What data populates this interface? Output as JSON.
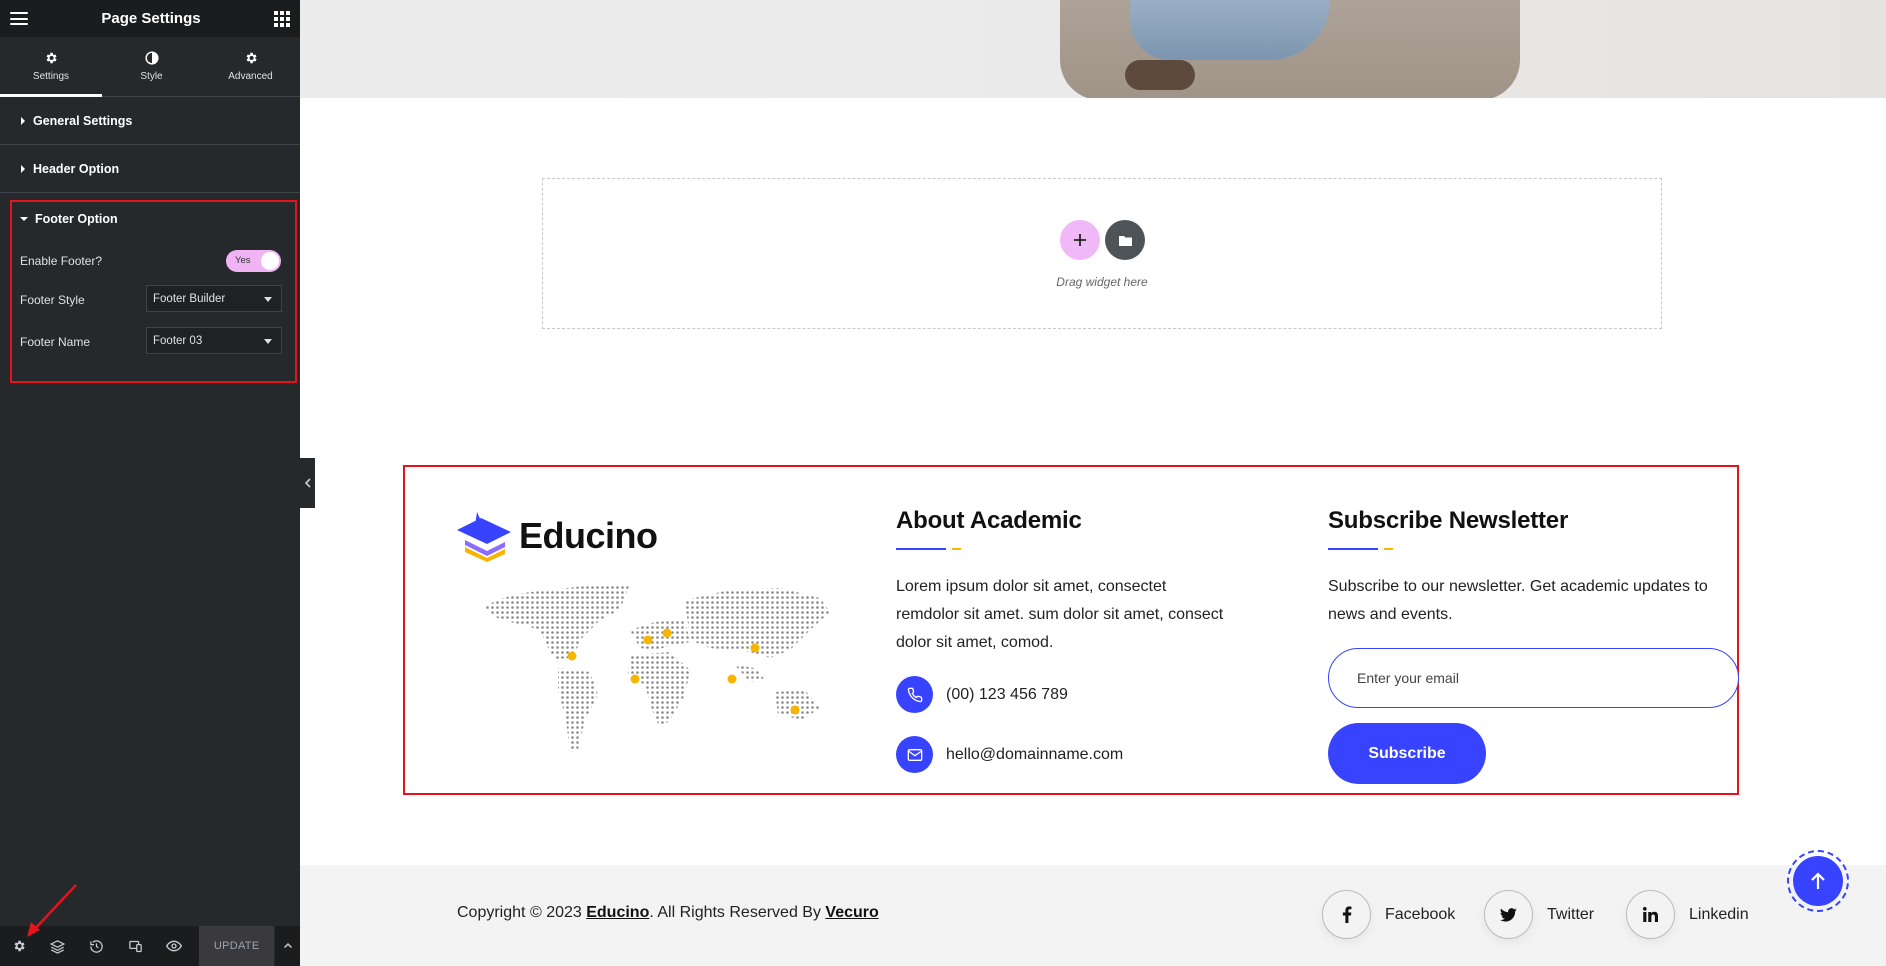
{
  "panel": {
    "title": "Page Settings",
    "tabs": [
      {
        "label": "Settings",
        "icon": "gear-icon"
      },
      {
        "label": "Style",
        "icon": "contrast-icon"
      },
      {
        "label": "Advanced",
        "icon": "gear-icon"
      }
    ],
    "sections": {
      "general": "General Settings",
      "header": "Header Option",
      "footer": "Footer Option"
    },
    "footer_controls": {
      "enable_label": "Enable Footer?",
      "enable_value": "Yes",
      "style_label": "Footer Style",
      "style_value": "Footer Builder",
      "name_label": "Footer Name",
      "name_value": "Footer 03"
    },
    "bottom": {
      "update_label": "UPDATE"
    }
  },
  "drop_zone": {
    "text": "Drag widget here"
  },
  "footer": {
    "brand": "Educino",
    "about": {
      "title": "About Academic",
      "text": "Lorem ipsum dolor sit amet, consectet remdolor sit amet. sum dolor sit amet, consect dolor sit amet, comod.",
      "phone": "(00) 123 456 789",
      "email": "hello@domainname.com"
    },
    "newsletter": {
      "title": "Subscribe Newsletter",
      "text": "Subscribe to our newsletter. Get academic updates to news and events.",
      "placeholder": "Enter your email",
      "button": "Subscribe"
    }
  },
  "bottom_bar": {
    "copyright_prefix": "Copyright",
    "copyright_symbol": "©",
    "year": "2023",
    "brand_link": "Educino",
    "rights": ". All Rights Reserved By",
    "company_link": "Vecuro",
    "social": [
      {
        "label": "Facebook",
        "icon": "facebook-icon"
      },
      {
        "label": "Twitter",
        "icon": "twitter-icon"
      },
      {
        "label": "Linkedin",
        "icon": "linkedin-icon"
      }
    ]
  },
  "colors": {
    "panel_bg": "#26292c",
    "accent_blue": "#3843ff",
    "accent_yellow": "#f7b500",
    "highlight_red": "#e8121c",
    "toggle_pink": "#f0b3f4"
  }
}
